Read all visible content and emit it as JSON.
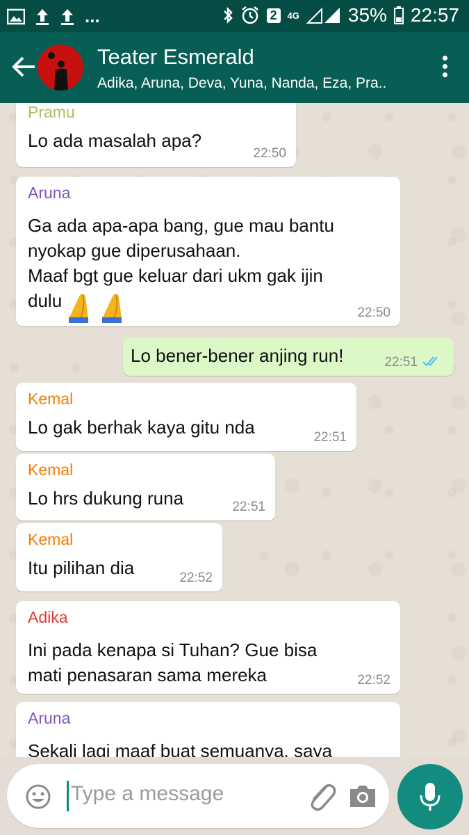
{
  "statusbar": {
    "battery": "35%",
    "time": "22:57",
    "sim_badge": "2",
    "network": "4G",
    "more": "..."
  },
  "header": {
    "title": "Teater Esmerald",
    "subtitle": "Adika, Aruna, Deva, Yuna, Nanda, Eza, Pra.."
  },
  "messages": [
    {
      "sender": "Pramu",
      "sender_color": "#a5c25c",
      "text": "Lo ada masalah apa?",
      "time": "22:50"
    },
    {
      "sender": "Aruna",
      "sender_color": "#7e57c2",
      "text": "Ga ada apa-apa bang, gue mau bantu\nnyokap gue diperusahaan.\nMaaf bgt gue keluar dari ukm gak ijin\ndulu",
      "time": "22:50"
    },
    {
      "sender": "",
      "text": "Lo bener-bener anjing run!",
      "time": "22:51"
    },
    {
      "sender": "Kemal",
      "sender_color": "#f57c00",
      "text": "Lo gak berhak kaya gitu nda",
      "time": "22:51"
    },
    {
      "sender": "Kemal",
      "sender_color": "#f57c00",
      "text": "Lo hrs dukung runa",
      "time": "22:51"
    },
    {
      "sender": "Kemal",
      "sender_color": "#f57c00",
      "text": "Itu pilihan dia",
      "time": "22:52"
    },
    {
      "sender": "Adika",
      "sender_color": "#e53935",
      "text": "Ini pada kenapa si Tuhan? Gue bisa\nmati penasaran sama mereka",
      "time": "22:52"
    },
    {
      "sender": "Aruna",
      "sender_color": "#7e57c2",
      "text": "Sekali lagi maaf buat semuanya, saya",
      "time": ""
    }
  ],
  "input": {
    "placeholder": "Type a message"
  },
  "colors": {
    "header": "#075e54",
    "statusbar": "#054d44",
    "outgoing": "#dcf8c6",
    "fab": "#128c7e"
  }
}
